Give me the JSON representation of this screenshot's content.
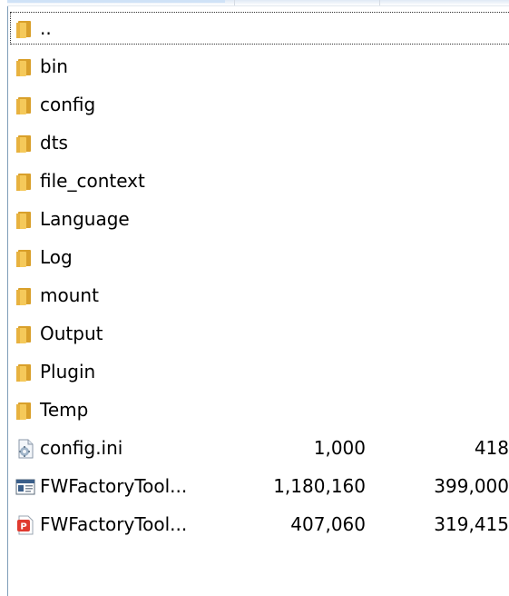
{
  "files": [
    {
      "name": "..",
      "type": "folder"
    },
    {
      "name": "bin",
      "type": "folder"
    },
    {
      "name": "config",
      "type": "folder"
    },
    {
      "name": "dts",
      "type": "folder"
    },
    {
      "name": "file_context",
      "type": "folder"
    },
    {
      "name": "Language",
      "type": "folder"
    },
    {
      "name": "Log",
      "type": "folder"
    },
    {
      "name": "mount",
      "type": "folder"
    },
    {
      "name": "Output",
      "type": "folder"
    },
    {
      "name": "Plugin",
      "type": "folder"
    },
    {
      "name": "Temp",
      "type": "folder"
    },
    {
      "name": "config.ini",
      "type": "ini",
      "size": "1,000",
      "packed": "418"
    },
    {
      "name": "FWFactoryTool...",
      "type": "exe",
      "size": "1,180,160",
      "packed": "399,000"
    },
    {
      "name": "FWFactoryTool...",
      "type": "pdf",
      "size": "407,060",
      "packed": "319,415"
    }
  ],
  "colors": {
    "folder": "#f2c14e",
    "folder_dark": "#d9a02b",
    "pdf": "#e03a2f",
    "selection_border": "#333333"
  }
}
